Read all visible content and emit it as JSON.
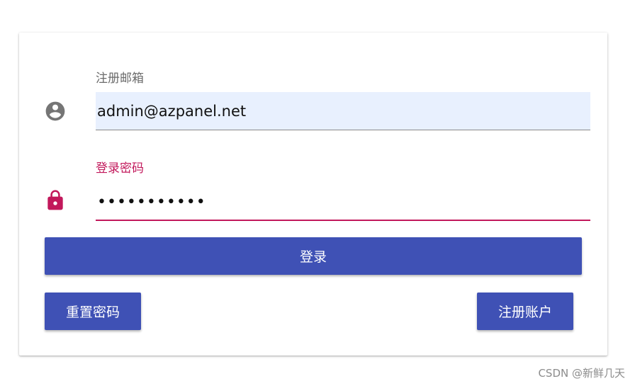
{
  "form": {
    "email": {
      "label": "注册邮箱",
      "value": "admin@azpanel.net",
      "icon": "account-circle-icon"
    },
    "password": {
      "label": "登录密码",
      "value": "•••••••••••",
      "icon": "lock-icon",
      "focused_color": "#c2185b"
    }
  },
  "buttons": {
    "login": "登录",
    "reset_password": "重置密码",
    "register": "注册账户",
    "color": "#3f51b5"
  },
  "watermark": "CSDN @新鲜几天"
}
